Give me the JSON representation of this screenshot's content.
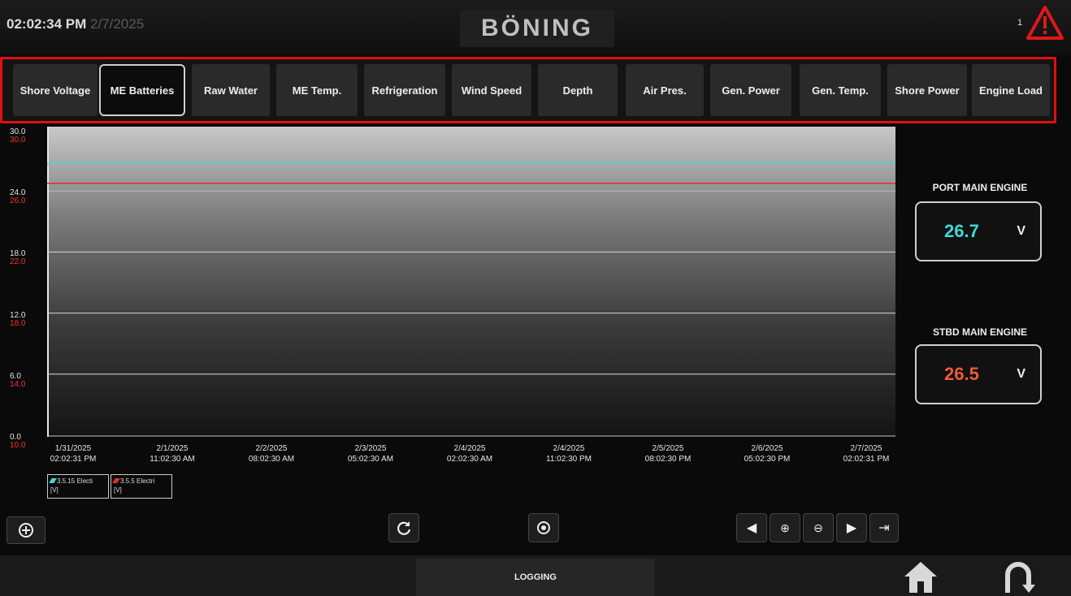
{
  "header": {
    "time": "02:02:34 PM",
    "date": "2/7/2025",
    "logo": "BÖNING",
    "alarm_count": "1"
  },
  "tabs": [
    {
      "label": "Shore Voltage",
      "active": false
    },
    {
      "label": "ME Batteries",
      "active": true
    },
    {
      "label": "Raw Water",
      "active": false
    },
    {
      "label": "ME Temp.",
      "active": false
    },
    {
      "label": "Refrigeration",
      "active": false
    },
    {
      "label": "Wind Speed",
      "active": false
    },
    {
      "label": "Depth",
      "active": false
    },
    {
      "label": "Air Pres.",
      "active": false
    },
    {
      "label": "Gen. Power",
      "active": false
    },
    {
      "label": "Gen. Temp.",
      "active": false
    },
    {
      "label": "Shore Power",
      "active": false
    },
    {
      "label": "Engine Load",
      "active": false
    }
  ],
  "chart": {
    "y_left_ticks": [
      "30.0",
      "24.0",
      "18.0",
      "12.0",
      "6.0",
      "0.0"
    ],
    "y_right_ticks": [
      "30.0",
      "26.0",
      "22.0",
      "18.0",
      "14.0",
      "10.0"
    ],
    "x_ticks": [
      {
        "date": "1/31/2025",
        "time": "02:02:31 PM"
      },
      {
        "date": "2/1/2025",
        "time": "11:02:30 AM"
      },
      {
        "date": "2/2/2025",
        "time": "08:02:30 AM"
      },
      {
        "date": "2/3/2025",
        "time": "05:02:30 AM"
      },
      {
        "date": "2/4/2025",
        "time": "02:02:30 AM"
      },
      {
        "date": "2/4/2025",
        "time": "11:02:30 PM"
      },
      {
        "date": "2/5/2025",
        "time": "08:02:30 PM"
      },
      {
        "date": "2/6/2025",
        "time": "05:02:30 PM"
      },
      {
        "date": "2/7/2025",
        "time": "02:02:31 PM"
      }
    ],
    "legend": [
      {
        "label": "3.5.15 Electi",
        "unit": "[V]",
        "color": "#40d8d8"
      },
      {
        "label": "3.5.5 Electri",
        "unit": "[V]",
        "color": "#e03030"
      }
    ]
  },
  "chart_data": {
    "type": "line",
    "y_left_range": [
      0,
      30
    ],
    "y_right_range": [
      10,
      30
    ],
    "series": [
      {
        "name": "3.5.15 Electi",
        "color": "#40d8d8",
        "axis": "left",
        "value": 26.7
      },
      {
        "name": "3.5.5 Electri",
        "color": "#e03030",
        "axis": "right",
        "value": 26.5
      }
    ]
  },
  "engines": {
    "port": {
      "title": "PORT MAIN ENGINE",
      "value": "26.7",
      "unit": "V",
      "color": "#40d8d8"
    },
    "stbd": {
      "title": "STBD MAIN ENGINE",
      "value": "26.5",
      "unit": "V",
      "color": "#f05a3a"
    }
  },
  "footer": {
    "logging_label": "LOGGING"
  },
  "icons": {
    "add": "plus-circle-icon",
    "refresh": "refresh-icon",
    "reset": "reset-zoom-icon",
    "nav": [
      "arrow-left-icon",
      "zoom-in-icon",
      "zoom-out-icon",
      "arrow-right-icon",
      "arrow-end-icon"
    ],
    "home": "home-icon",
    "back": "back-arrow-icon"
  }
}
